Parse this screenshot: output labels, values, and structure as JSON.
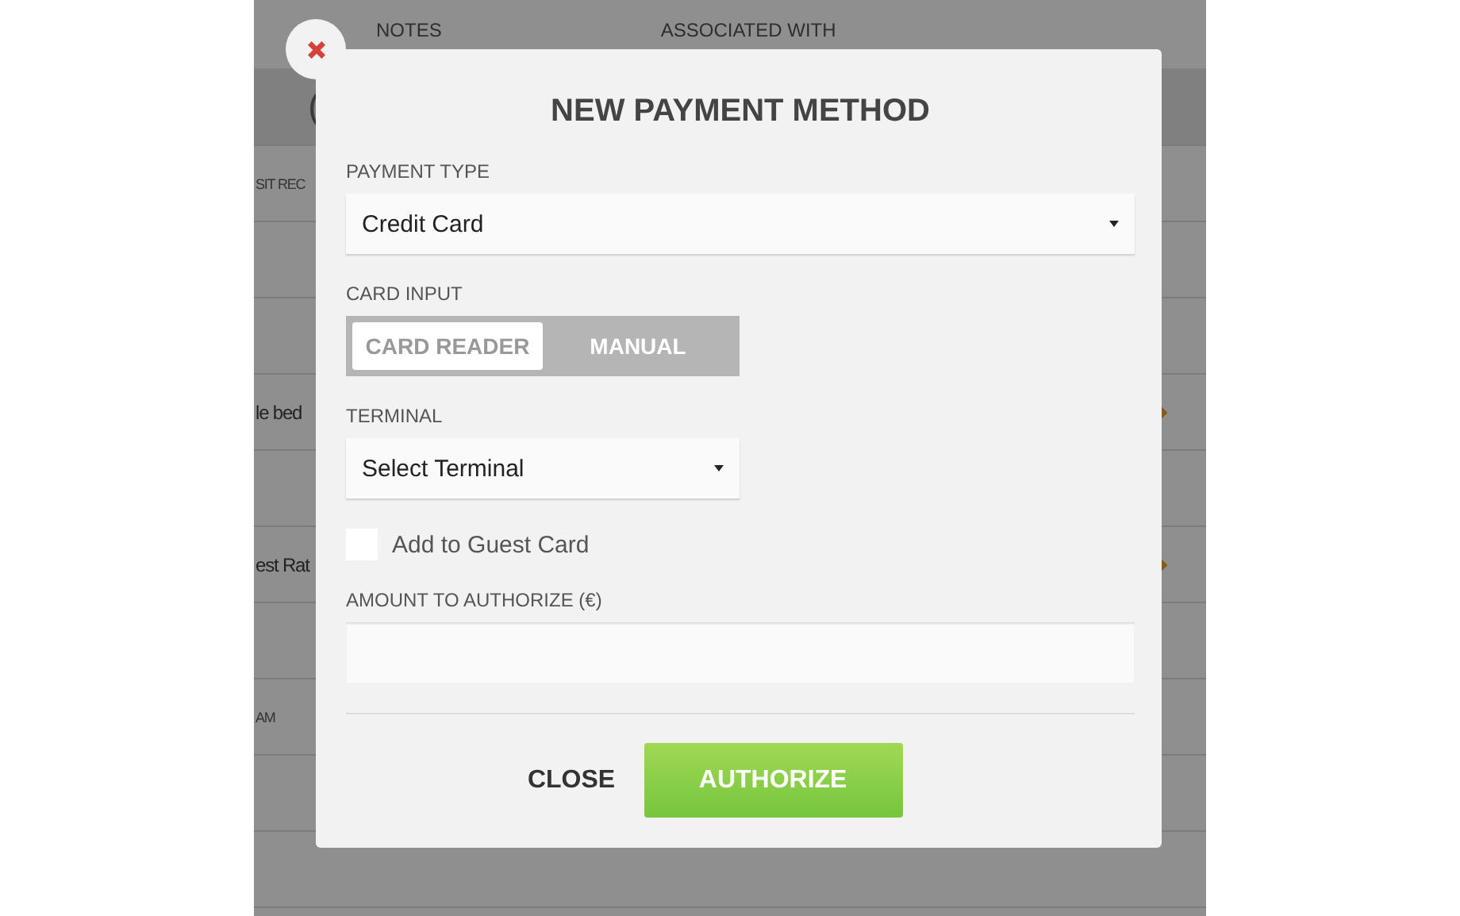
{
  "background": {
    "columns": [
      "NOTES",
      "ASSOCIATED WITH"
    ],
    "rows": [
      {
        "kind": "text",
        "text": "(",
        "chevron": false,
        "dark": true
      },
      {
        "kind": "text",
        "text": "SIT REC",
        "chevron": false,
        "dark": false
      },
      {
        "kind": "blank"
      },
      {
        "kind": "blank"
      },
      {
        "kind": "text",
        "text": "le bed",
        "chevron": true,
        "dark": false
      },
      {
        "kind": "blank"
      },
      {
        "kind": "text",
        "text": "est Rat",
        "chevron": true,
        "dark": false
      },
      {
        "kind": "blank"
      },
      {
        "kind": "text",
        "text": "AM",
        "chevron": false,
        "dark": false
      },
      {
        "kind": "blank"
      },
      {
        "kind": "blank"
      }
    ]
  },
  "dialog": {
    "title": "NEW PAYMENT METHOD",
    "payment_type": {
      "label": "PAYMENT TYPE",
      "value": "Credit Card"
    },
    "card_input": {
      "label": "CARD INPUT",
      "options": [
        {
          "label": "CARD READER",
          "selected": true
        },
        {
          "label": "MANUAL",
          "selected": false
        }
      ]
    },
    "terminal": {
      "label": "TERMINAL",
      "value": "Select Terminal"
    },
    "add_to_guest_card": {
      "label": "Add to Guest Card",
      "checked": false
    },
    "amount": {
      "label": "AMOUNT TO AUTHORIZE (€)"
    },
    "buttons": [
      {
        "kind": "plain",
        "label": "CLOSE"
      },
      {
        "kind": "primary",
        "label": "AUTHORIZE"
      }
    ]
  }
}
